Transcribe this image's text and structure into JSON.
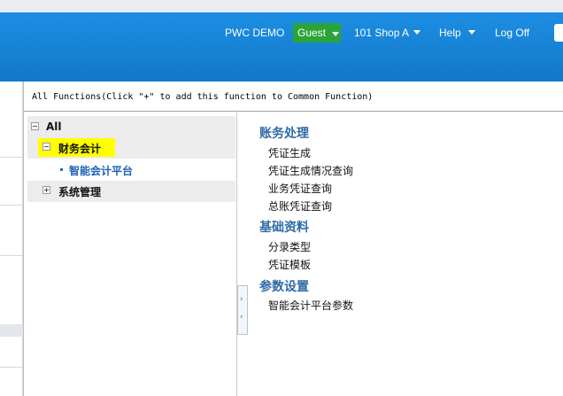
{
  "header": {
    "nav": [
      "PWC DEMO",
      "Guest",
      "101 Shop A",
      "Help",
      "Log Off"
    ]
  },
  "panel": {
    "title": "All Functions(Click \"+\" to add this function to Common Function)"
  },
  "tree": {
    "root": "All",
    "nodes": [
      {
        "label": "财务会计",
        "children": [
          "智能会计平台"
        ]
      },
      {
        "label": "系统管理",
        "children": []
      }
    ]
  },
  "content": {
    "sections": [
      {
        "title": "账务处理",
        "items": [
          "凭证生成",
          "凭证生成情况查询",
          "业务凭证查询",
          "总账凭证查询"
        ]
      },
      {
        "title": "基础资料",
        "items": [
          "分录类型",
          "凭证模板"
        ]
      },
      {
        "title": "参数设置",
        "items": [
          "智能会计平台参数"
        ]
      }
    ]
  },
  "colors": {
    "header": "#1a88de",
    "guest_highlight": "#2aa43a",
    "tree_highlight": "#ffff00",
    "section_title": "#2f6aa8"
  }
}
